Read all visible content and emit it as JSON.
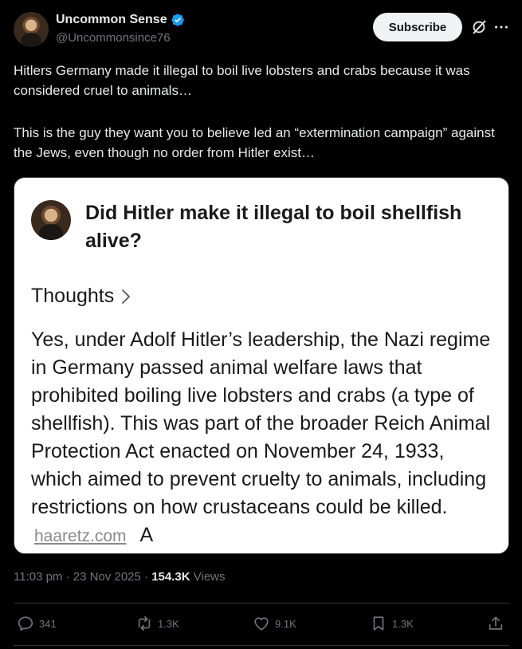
{
  "author": {
    "display_name": "Uncommon Sense",
    "handle": "@Uncommonsince76",
    "verified": true
  },
  "header": {
    "subscribe_label": "Subscribe",
    "grok_icon": "grok-icon",
    "more_icon": "more-icon"
  },
  "tweet": {
    "paragraph1": "Hitlers Germany made it illegal to boil live lobsters and crabs because it was considered cruel to animals…",
    "paragraph2": "This is the guy they want you to believe led an “extermination campaign” against the Jews, even though no order from Hitler exist…"
  },
  "media": {
    "question": "Did Hitler make it illegal to boil shellfish alive?",
    "thoughts_label": "Thoughts",
    "answer": "Yes, under Adolf Hitler’s leadership, the Nazi regime in Germany passed animal welfare laws that prohibited boiling live lobsters and crabs (a type of shellfish). This was part of the broader Reich Animal Protection Act enacted on November 24, 1933, which aimed to prevent cruelty to animals, including restrictions on how crustaceans could be killed.",
    "source_link": "haaretz.com",
    "trailing_text": "A"
  },
  "meta": {
    "time": "11:03 pm",
    "date": "23 Nov 2025",
    "views_count": "154.3K",
    "views_label": "Views"
  },
  "actions": {
    "replies": "341",
    "reposts": "1.3K",
    "likes": "9.1K",
    "bookmarks": "1.3K"
  },
  "colors": {
    "background": "#000000",
    "text_primary": "#e7e9ea",
    "text_secondary": "#71767b",
    "verified_blue": "#1d9bf0",
    "divider": "#2f3336"
  }
}
